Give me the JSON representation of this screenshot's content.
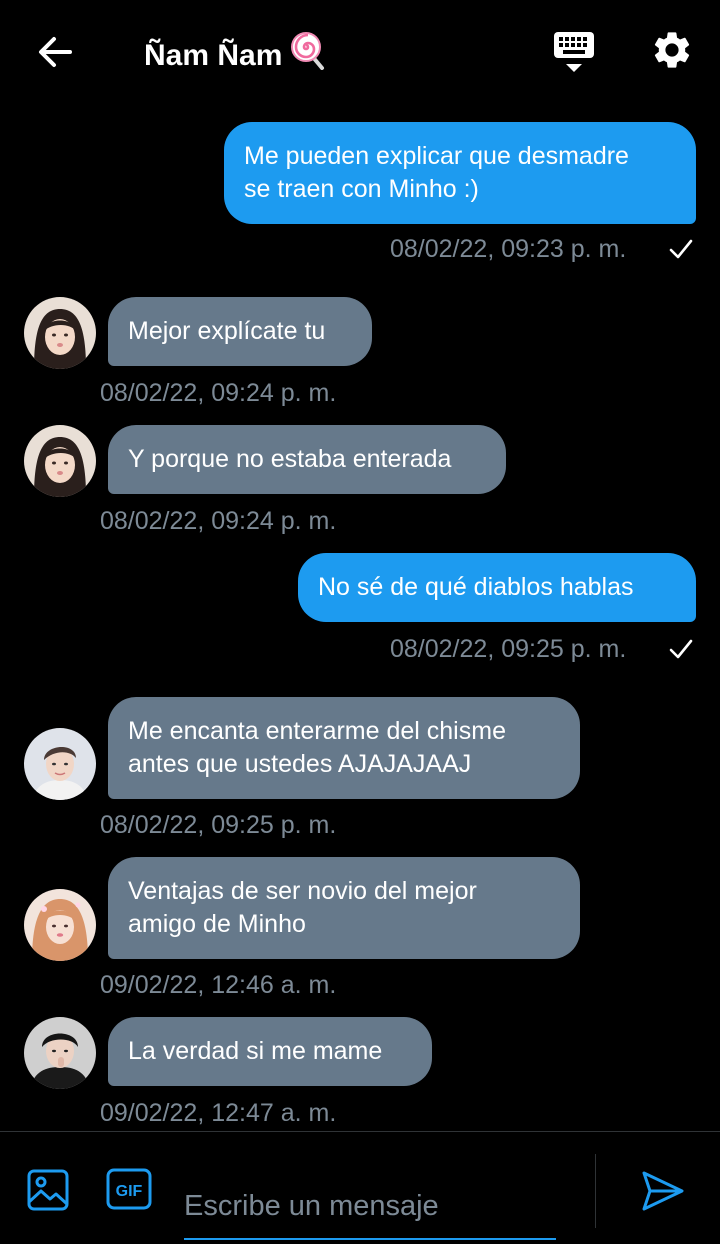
{
  "header": {
    "title": "Ñam Ñam",
    "emoji": "🍭",
    "icons": [
      "back-arrow-icon",
      "keyboard-icon",
      "settings-gear-icon"
    ]
  },
  "colors": {
    "accent": "#1d9bf0",
    "incoming_bubble": "#66798b",
    "timestamp": "#7d8a96",
    "background": "#000000"
  },
  "messages": [
    {
      "direction": "outgoing",
      "lines": [
        "Me pueden explicar que desmadre",
        "se traen con Minho :)"
      ],
      "timestamp": "08/02/22, 09:23 p. m.",
      "read": true
    },
    {
      "direction": "incoming",
      "avatar": "avatar-girl-1",
      "lines": [
        "Mejor explícate tu"
      ],
      "timestamp": "08/02/22, 09:24 p. m."
    },
    {
      "direction": "incoming",
      "avatar": "avatar-girl-1",
      "lines": [
        "Y porque no estaba enterada"
      ],
      "timestamp": "08/02/22, 09:24 p. m."
    },
    {
      "direction": "outgoing",
      "lines": [
        "No sé de qué diablos hablas"
      ],
      "timestamp": "08/02/22, 09:25 p. m.",
      "read": true
    },
    {
      "direction": "incoming",
      "avatar": "avatar-boy-1",
      "lines": [
        "Me encanta enterarme del chisme",
        "antes que ustedes AJAJAJAAJ"
      ],
      "timestamp": "08/02/22, 09:25 p. m."
    },
    {
      "direction": "incoming",
      "avatar": "avatar-girl-2",
      "lines": [
        "Ventajas de ser novio del mejor",
        "amigo de Minho"
      ],
      "timestamp": "09/02/22, 12:46 a. m."
    },
    {
      "direction": "incoming",
      "avatar": "avatar-boy-2",
      "lines": [
        "La verdad si me mame"
      ],
      "timestamp": "09/02/22, 12:47 a. m."
    }
  ],
  "composer": {
    "placeholder": "Escribe un mensaje",
    "gif_label": "GIF",
    "icons": [
      "image-icon",
      "gif-icon",
      "send-icon"
    ]
  }
}
